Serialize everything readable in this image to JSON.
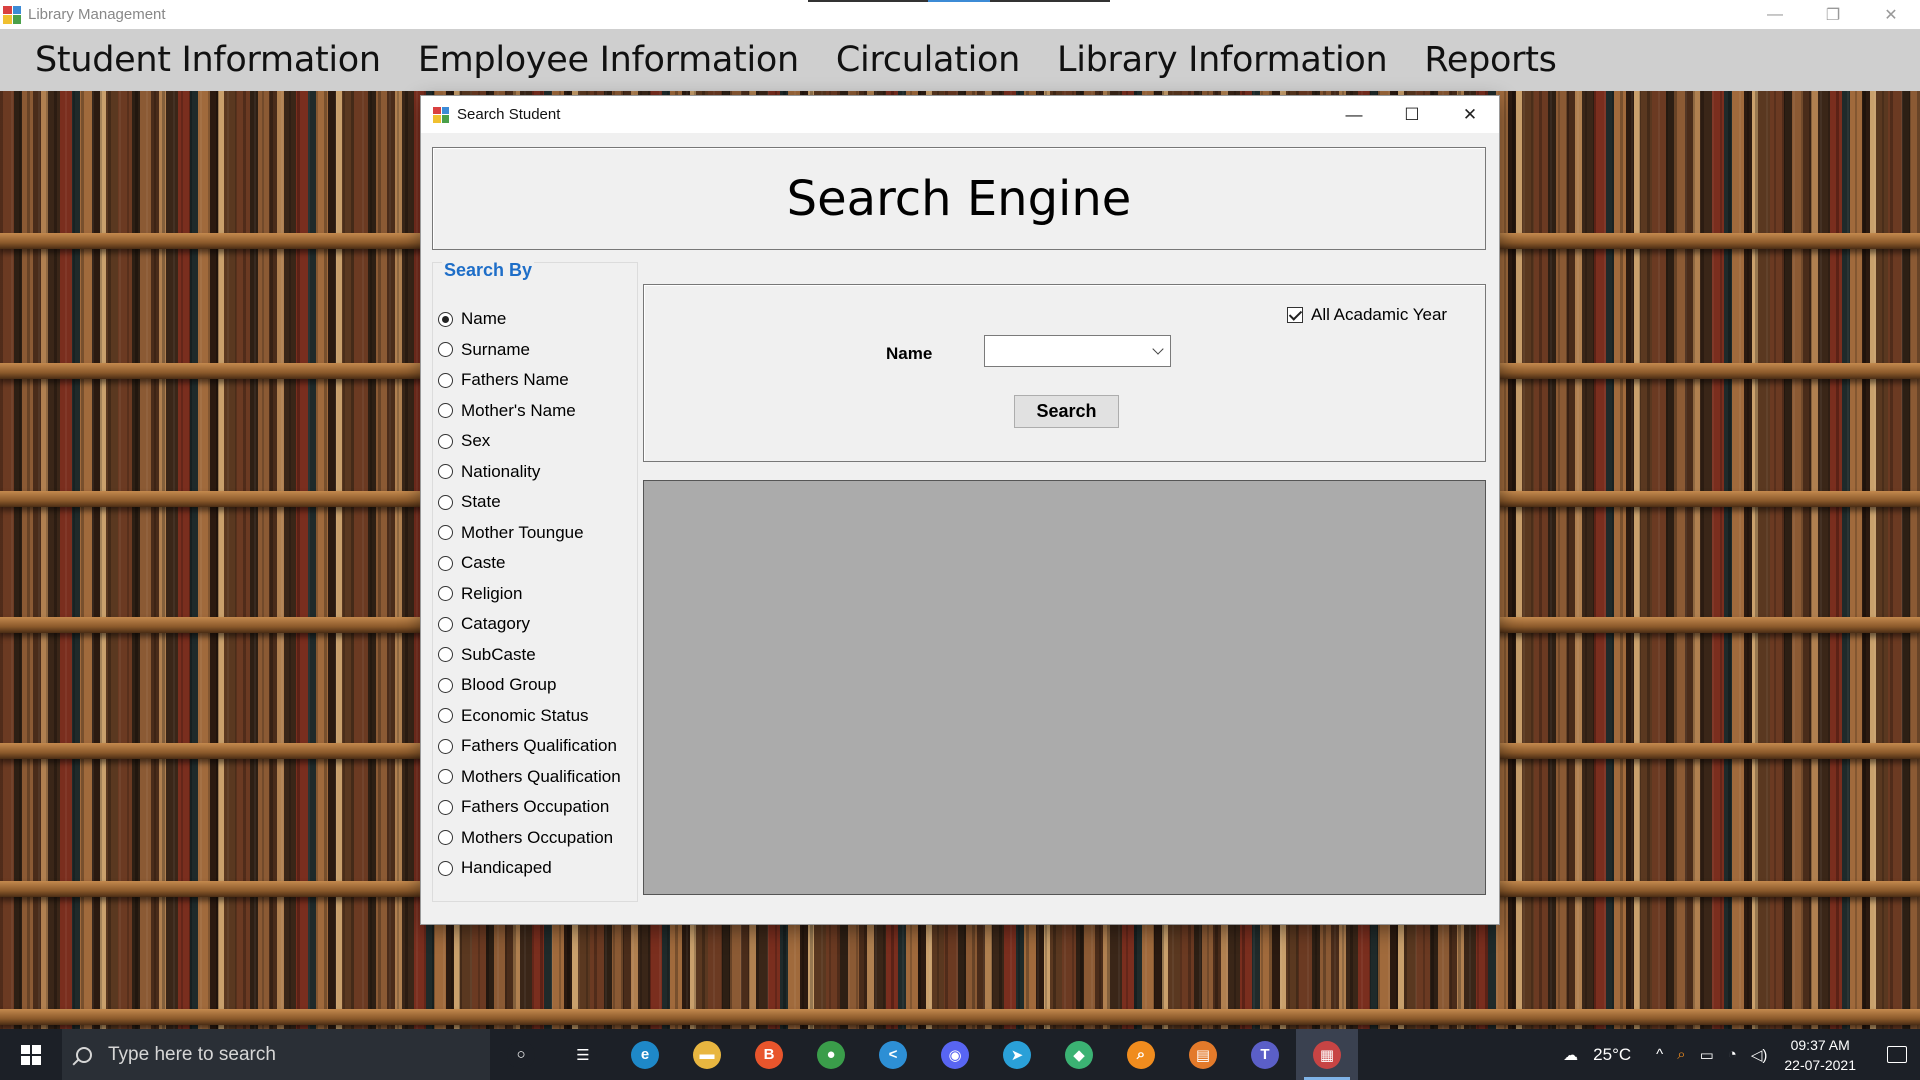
{
  "app": {
    "title": "Library Management",
    "minimize_glyph": "—",
    "restore_glyph": "❐",
    "close_glyph": "✕"
  },
  "menu": [
    "Student Information",
    "Employee Information",
    "Circulation",
    "Library Information",
    "Reports"
  ],
  "dialog": {
    "title": "Search Student",
    "minimize_glyph": "—",
    "maximize_glyph": "☐",
    "close_glyph": "✕",
    "header": "Search Engine",
    "search_by_label": "Search By",
    "options": [
      "Name",
      "Surname",
      "Fathers Name",
      "Mother's Name",
      "Sex",
      "Nationality",
      "State",
      "Mother Toungue",
      "Caste",
      "Religion",
      "Catagory",
      "SubCaste",
      "Blood Group",
      "Economic Status",
      "Fathers Qualification",
      "Mothers Qualification",
      "Fathers Occupation",
      "Mothers Occupation",
      "Handicaped"
    ],
    "selected_option": "Name",
    "all_year_label": "All Acadamic Year",
    "all_year_checked": true,
    "field_label": "Name",
    "field_value": "",
    "search_button": "Search"
  },
  "taskbar": {
    "search_placeholder": "Type here to search",
    "apps": [
      {
        "name": "task-view-icon",
        "glyph": "○",
        "color": "#1c2027"
      },
      {
        "name": "widgets-icon",
        "glyph": "☰",
        "color": "#1c2027"
      },
      {
        "name": "edge-icon",
        "glyph": "e",
        "color": "#1e88c8"
      },
      {
        "name": "file-explorer-icon",
        "glyph": "▬",
        "color": "#e8b640"
      },
      {
        "name": "brave-icon",
        "glyph": "B",
        "color": "#e8552c"
      },
      {
        "name": "chrome-icon",
        "glyph": "●",
        "color": "#3a9d4a"
      },
      {
        "name": "vscode-icon",
        "glyph": "<",
        "color": "#2d8fd5"
      },
      {
        "name": "discord-icon",
        "glyph": "◉",
        "color": "#5865f2"
      },
      {
        "name": "telegram-icon",
        "glyph": "➤",
        "color": "#2aa0d8"
      },
      {
        "name": "git-icon",
        "glyph": "◆",
        "color": "#3bb273"
      },
      {
        "name": "search-app-icon",
        "glyph": "⌕",
        "color": "#f08c1e"
      },
      {
        "name": "notes-icon",
        "glyph": "▤",
        "color": "#e37a2a"
      },
      {
        "name": "teams-icon",
        "glyph": "T",
        "color": "#5b5fc7"
      },
      {
        "name": "library-app-icon",
        "glyph": "▦",
        "color": "#c74444"
      }
    ],
    "temperature": "25°C",
    "tray_symbols": [
      "^",
      "⌕",
      "▭",
      "◔",
      "◁)"
    ],
    "time": "09:37 AM",
    "date": "22-07-2021"
  }
}
